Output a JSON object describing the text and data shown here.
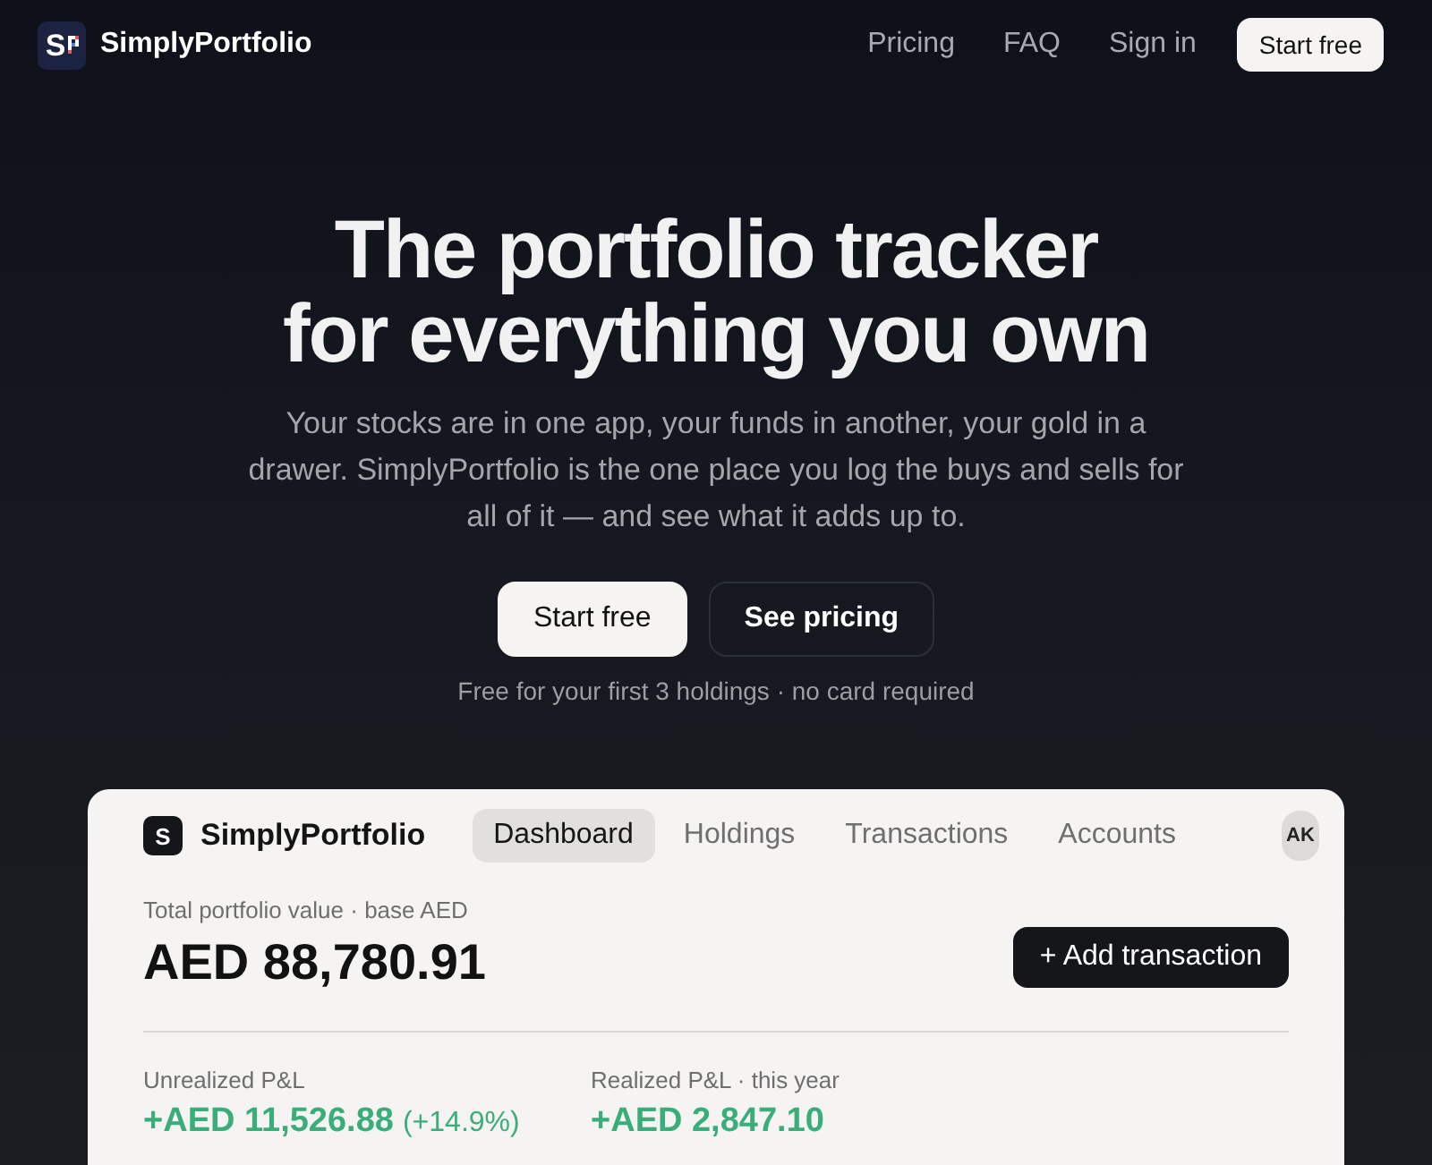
{
  "nav": {
    "brand": {
      "mark": "S",
      "name": "SimplyPortfolio"
    },
    "links": [
      "Pricing",
      "FAQ",
      "Sign in"
    ],
    "cta": "Start free"
  },
  "hero": {
    "title_lines": [
      "The portfolio tracker",
      "for everything you own"
    ],
    "subtitle": "Your stocks are in one app, your funds in another, your gold in a drawer. SimplyPortfolio is the one place you log the buys and sells for all of it — and see what it adds up to.",
    "buttons": [
      {
        "label": "Start free",
        "kind": "primary"
      },
      {
        "label": "See pricing",
        "kind": "secondary"
      }
    ],
    "note": "Free for your first 3 holdings · no card required"
  },
  "app_preview": {
    "brand": {
      "mark": "S",
      "name": "SimplyPortfolio"
    },
    "tabs": [
      {
        "label": "Dashboard",
        "selected": true
      },
      {
        "label": "Holdings",
        "selected": false
      },
      {
        "label": "Transactions",
        "selected": false
      },
      {
        "label": "Accounts",
        "selected": false
      }
    ],
    "avatar": "AK",
    "total": {
      "label": "Total portfolio value · base AED",
      "value": "AED 88,780.91"
    },
    "action": "+ Add transaction",
    "stats": [
      {
        "label": "Unrealized P&L",
        "value": "+AED 11,526.88",
        "change": "(+14.9%)"
      },
      {
        "label": "Realized P&L · this year",
        "value": "+AED 2,847.10"
      }
    ]
  }
}
